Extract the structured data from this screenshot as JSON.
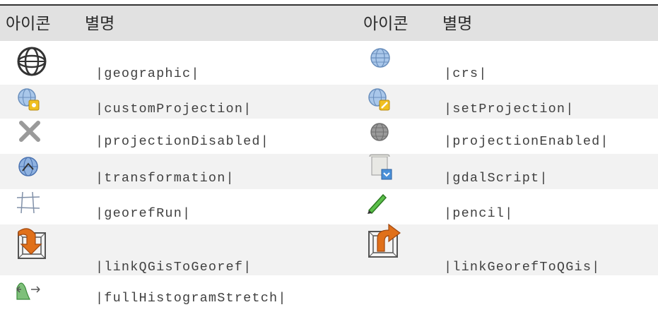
{
  "table": {
    "headers": {
      "icon_col_1": "아이콘",
      "alias_col_1": "별명",
      "icon_col_2": "아이콘",
      "alias_col_2": "별명"
    },
    "rows": [
      {
        "left": {
          "icon": "globe-wireframe-icon",
          "alias": "|geographic|"
        },
        "right": {
          "icon": "crs-globe-icon",
          "alias": "|crs|"
        }
      },
      {
        "left": {
          "icon": "custom-projection-icon",
          "alias": "|customProjection|"
        },
        "right": {
          "icon": "set-projection-icon",
          "alias": "|setProjection|"
        }
      },
      {
        "left": {
          "icon": "projection-disabled-icon",
          "alias": "|projectionDisabled|"
        },
        "right": {
          "icon": "projection-enabled-icon",
          "alias": "|projectionEnabled|"
        }
      },
      {
        "left": {
          "icon": "transformation-icon",
          "alias": "|transformation|"
        },
        "right": {
          "icon": "gdal-script-icon",
          "alias": "|gdalScript|"
        }
      },
      {
        "left": {
          "icon": "georef-run-icon",
          "alias": "|georefRun|"
        },
        "right": {
          "icon": "pencil-icon",
          "alias": "|pencil|"
        }
      },
      {
        "left": {
          "icon": "link-qgis-to-georef-icon",
          "alias": "|linkQGisToGeoref|"
        },
        "right": {
          "icon": "link-georef-to-qgis-icon",
          "alias": "|linkGeorefToQGis|"
        }
      },
      {
        "left": {
          "icon": "full-histogram-stretch-icon",
          "alias": "|fullHistogramStretch|"
        }
      }
    ]
  },
  "colors": {
    "header_bg": "#e1e1e1",
    "stripe_bg": "#f2f2f2",
    "globe_blue": "#7fa6d6",
    "badge_yellow": "#f0c020",
    "arrow_orange": "#e0701a",
    "pencil_green": "#3aa43a"
  }
}
